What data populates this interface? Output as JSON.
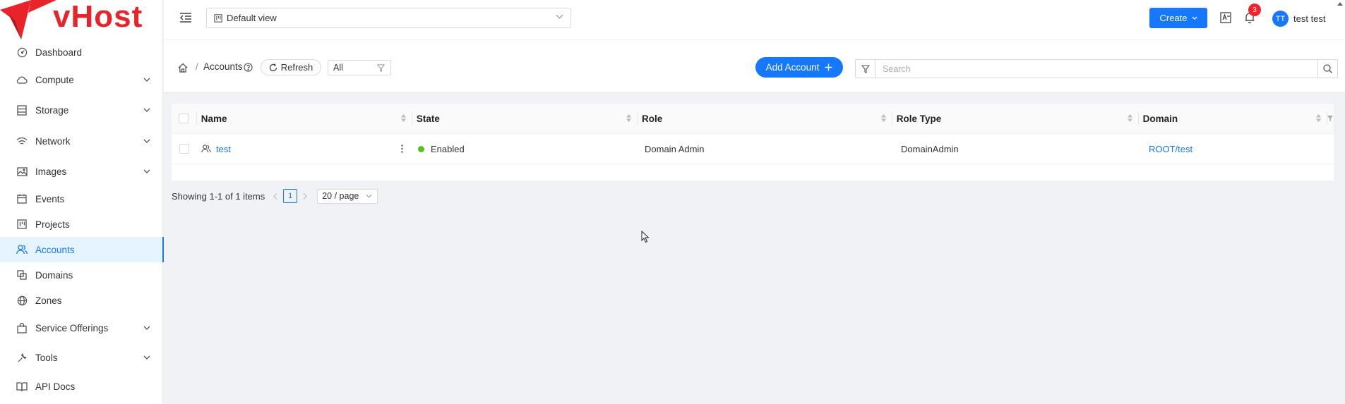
{
  "brand": {
    "name": "vHost",
    "color": "#e8232a"
  },
  "theme": {
    "accent": "#1677ff",
    "success": "#52c41a",
    "danger": "#f5222d"
  },
  "sidebar": {
    "items": [
      {
        "label": "Dashboard",
        "icon": "dashboard-icon",
        "expandable": false,
        "active": false
      },
      {
        "label": "Compute",
        "icon": "cloud-icon",
        "expandable": true,
        "active": false
      },
      {
        "label": "Storage",
        "icon": "database-icon",
        "expandable": true,
        "active": false
      },
      {
        "label": "Network",
        "icon": "wifi-icon",
        "expandable": true,
        "active": false
      },
      {
        "label": "Images",
        "icon": "picture-icon",
        "expandable": true,
        "active": false
      },
      {
        "label": "Events",
        "icon": "calendar-icon",
        "expandable": false,
        "active": false
      },
      {
        "label": "Projects",
        "icon": "project-icon",
        "expandable": false,
        "active": false
      },
      {
        "label": "Accounts",
        "icon": "team-icon",
        "expandable": false,
        "active": true
      },
      {
        "label": "Domains",
        "icon": "block-icon",
        "expandable": false,
        "active": false
      },
      {
        "label": "Zones",
        "icon": "global-icon",
        "expandable": false,
        "active": false
      },
      {
        "label": "Service Offerings",
        "icon": "shopping-icon",
        "expandable": true,
        "active": false
      },
      {
        "label": "Tools",
        "icon": "tool-icon",
        "expandable": true,
        "active": false
      },
      {
        "label": "API Docs",
        "icon": "read-icon",
        "expandable": false,
        "active": false
      }
    ]
  },
  "header": {
    "view_select": "Default view",
    "create_label": "Create",
    "notification_count": "3",
    "avatar_initials": "TT",
    "username": "test test"
  },
  "toolbar": {
    "breadcrumb_sep": "/",
    "breadcrumb_current": "Accounts",
    "refresh_label": "Refresh",
    "filter_value": "All",
    "add_label": "Add Account",
    "search_placeholder": "Search"
  },
  "table": {
    "columns": [
      "Name",
      "State",
      "Role",
      "Role Type",
      "Domain"
    ],
    "rows": [
      {
        "name": "test",
        "state": "Enabled",
        "role": "Domain Admin",
        "role_type": "DomainAdmin",
        "domain": "ROOT/test"
      }
    ]
  },
  "pagination": {
    "summary": "Showing 1-1 of 1 items",
    "current_page": "1",
    "page_size": "20 / page"
  }
}
